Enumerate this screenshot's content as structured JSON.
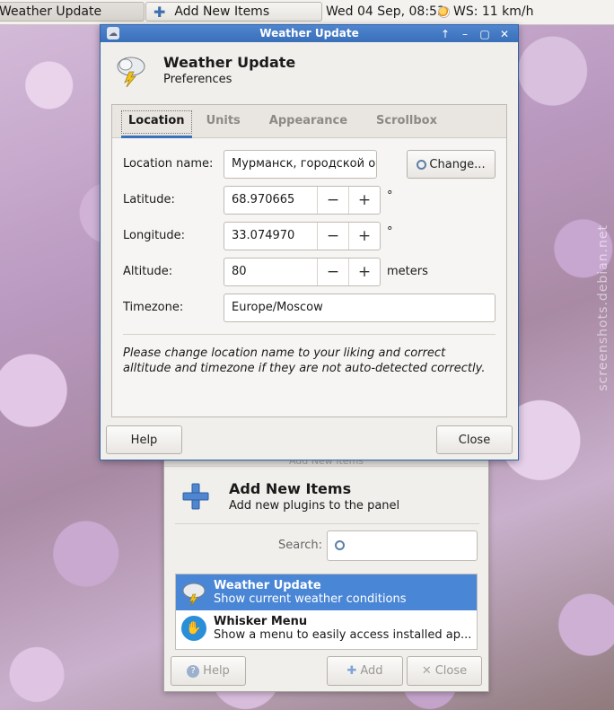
{
  "panel": {
    "tasks": [
      {
        "label": "Weather Update",
        "active": true
      },
      {
        "label": "Add New Items",
        "active": false
      }
    ],
    "clock": "Wed 04 Sep, 08:53",
    "weather": "WS: 11 km/h"
  },
  "weather_window": {
    "title": "Weather Update",
    "header_title": "Weather Update",
    "header_subtitle": "Preferences",
    "tabs": [
      "Location",
      "Units",
      "Appearance",
      "Scrollbox"
    ],
    "selected_tab": "Location",
    "location_name_label": "Location name:",
    "location_name_value": "Мурманск, городской округ Мурманск",
    "change_button": "Change...",
    "latitude_label": "Latitude:",
    "latitude_value": "68.970665",
    "latitude_unit": "°",
    "longitude_label": "Longitude:",
    "longitude_value": "33.074970",
    "longitude_unit": "°",
    "altitude_label": "Altitude:",
    "altitude_value": "80",
    "altitude_unit": "meters",
    "timezone_label": "Timezone:",
    "timezone_value": "Europe/Moscow",
    "note": "Please change location name to your liking and correct alltitude and timezone if they are not auto-detected correctly.",
    "help_button": "Help",
    "close_button": "Close"
  },
  "add_window": {
    "title": "Add New Items",
    "header_title": "Add New Items",
    "header_subtitle": "Add new plugins to the panel",
    "search_label": "Search:",
    "search_value": "",
    "items": [
      {
        "name": "Weather Update",
        "desc": "Show current weather conditions",
        "selected": true
      },
      {
        "name": "Whisker Menu",
        "desc": "Show a menu to easily access installed ap...",
        "selected": false
      }
    ],
    "help_button": "Help",
    "add_button": "Add",
    "close_button": "Close"
  },
  "watermark": "screenshots.debian.net"
}
